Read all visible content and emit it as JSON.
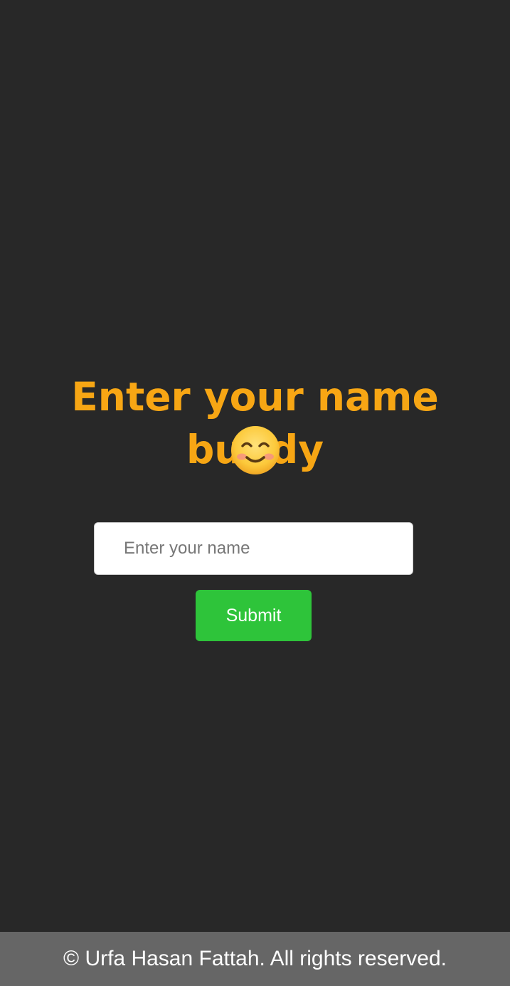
{
  "heading": {
    "text": "Enter your name buddy",
    "emoji_icon": "smiling-face-emoji",
    "color": "#f7a614"
  },
  "form": {
    "name_input": {
      "value": "",
      "placeholder": "Enter your name"
    },
    "submit_label": "Submit",
    "submit_color": "#2ec43a"
  },
  "footer": {
    "text": "© Urfa Hasan Fattah. All rights reserved.",
    "background": "#666666"
  },
  "background_color": "#282828"
}
